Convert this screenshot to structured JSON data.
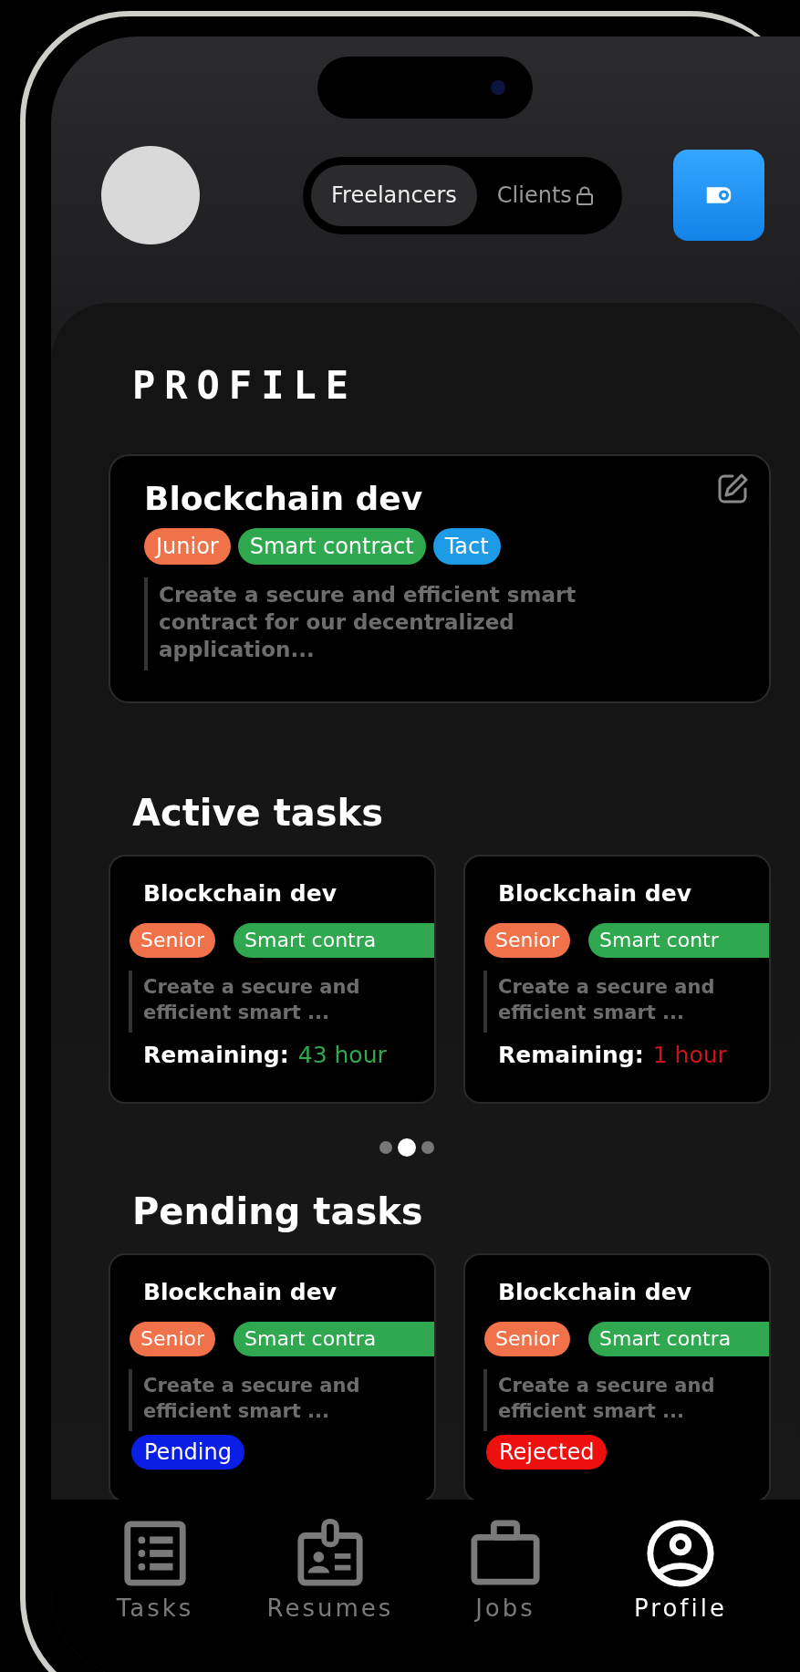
{
  "header": {
    "segments": [
      {
        "label": "Freelancers",
        "selected": true,
        "locked": false
      },
      {
        "label": "Clients",
        "selected": false,
        "locked": true
      }
    ]
  },
  "profile": {
    "heading": "PROFILE",
    "card": {
      "title": "Blockchain dev",
      "tags": [
        {
          "label": "Junior",
          "color": "#f0724a"
        },
        {
          "label": "Smart contract",
          "color": "#2fa84f"
        },
        {
          "label": "Tact",
          "color": "#1e9be6"
        }
      ],
      "description": "Create a secure and efficient smart contract for our decentralized application..."
    }
  },
  "active_tasks": {
    "heading": "Active tasks",
    "cards": [
      {
        "title": "Blockchain dev",
        "tags": [
          {
            "label": "Senior",
            "color": "#f0724a"
          },
          {
            "label": "Smart contra",
            "color": "#2fa84f"
          }
        ],
        "description": "Create a secure and efficient smart ...",
        "remaining_label": "Remaining:",
        "remaining_value": "43 hour",
        "color": "#2fa84f"
      },
      {
        "title": "Blockchain dev",
        "tags": [
          {
            "label": "Senior",
            "color": "#f0724a"
          },
          {
            "label": "Smart contr",
            "color": "#2fa84f"
          }
        ],
        "description": "Create a secure and efficient smart ...",
        "remaining_label": "Remaining:",
        "remaining_value": "1 hour",
        "color": "#c8151b"
      }
    ]
  },
  "carousel_dots": [
    {
      "selected": false
    },
    {
      "selected": true
    },
    {
      "selected": false
    }
  ],
  "pending_tasks": {
    "heading": "Pending tasks",
    "cards": [
      {
        "title": "Blockchain dev",
        "tags": [
          {
            "label": "Senior",
            "color": "#f0724a"
          },
          {
            "label": "Smart contra",
            "color": "#2fa84f"
          }
        ],
        "description": "Create a secure and efficient smart ...",
        "status": {
          "label": "Pending",
          "color": "#0a1ee6"
        }
      },
      {
        "title": "Blockchain dev",
        "tags": [
          {
            "label": "Senior",
            "color": "#f0724a"
          },
          {
            "label": "Smart contra",
            "color": "#2fa84f"
          }
        ],
        "description": "Create a secure and efficient smart ...",
        "status": {
          "label": "Rejected",
          "color": "#ee0f0f"
        }
      }
    ]
  },
  "nav": [
    {
      "kind": "list",
      "label": "Tasks",
      "selected": false
    },
    {
      "kind": "badge",
      "label": "Resumes",
      "selected": false
    },
    {
      "kind": "briefcase",
      "label": "Jobs",
      "selected": false
    },
    {
      "kind": "user",
      "label": "Profile",
      "selected": true
    }
  ]
}
